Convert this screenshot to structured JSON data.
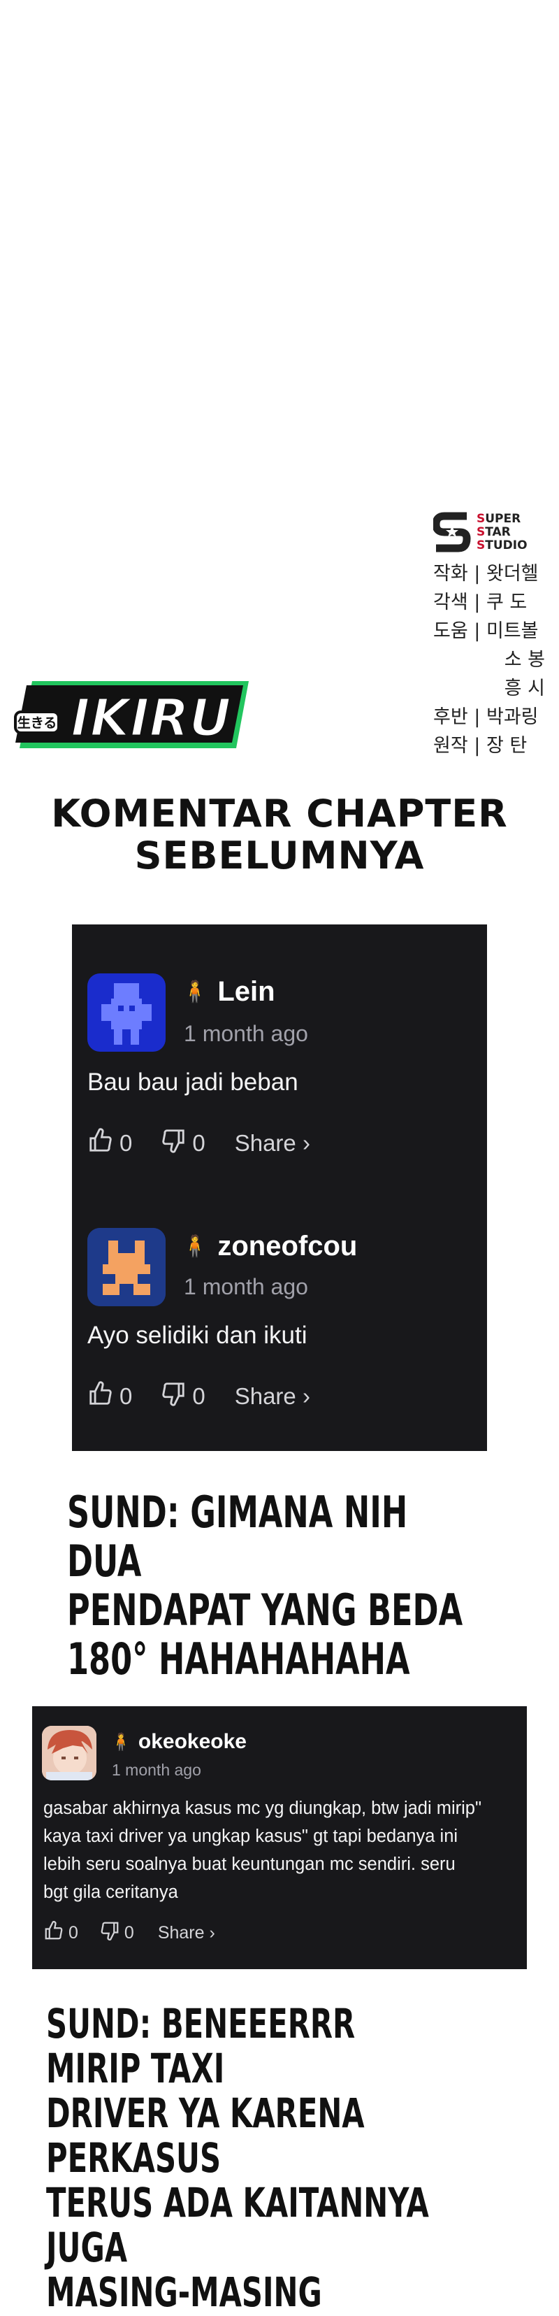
{
  "studio": {
    "logo_lines": [
      "SUPER",
      "STAR",
      "STUDIO"
    ],
    "credits": [
      {
        "role": "작화",
        "sep": "|",
        "name": "왓더헬"
      },
      {
        "role": "각색",
        "sep": "|",
        "name": "쿠 도"
      },
      {
        "role": "도움",
        "sep": "|",
        "name": "미트볼"
      },
      {
        "role": "",
        "sep": "",
        "name": "소 봉"
      },
      {
        "role": "",
        "sep": "",
        "name": "흥 시"
      },
      {
        "role": "후반",
        "sep": "|",
        "name": "박과링"
      },
      {
        "role": "원작",
        "sep": "|",
        "name": "장 탄"
      }
    ]
  },
  "logo": {
    "kana": "生きる",
    "word": "IKIRU"
  },
  "section_title": {
    "line1": "KOMENTAR CHAPTER",
    "line2": "SEBELUMNYA"
  },
  "comments_box1": [
    {
      "username": "Lein",
      "time": "1 month ago",
      "text": "Bau bau jadi beban",
      "likes": "0",
      "dislikes": "0",
      "share": "Share ›",
      "avatar_color": "#1a2ccc"
    },
    {
      "username": "zoneofcou",
      "time": "1 month ago",
      "text": "Ayo selidiki dan ikuti",
      "likes": "0",
      "dislikes": "0",
      "share": "Share ›",
      "avatar_color": "#1e3a8a"
    }
  ],
  "sund1": {
    "lines": [
      "SUND: GIMANA NIH DUA",
      "PENDAPAT YANG BEDA",
      "180° HAHAHAHAHA"
    ]
  },
  "comment_box2": {
    "username": "okeokeoke",
    "time": "1 month ago",
    "text_lines": [
      "gasabar akhirnya kasus mc yg diungkap, btw jadi mirip\"",
      "kaya taxi driver ya ungkap kasus\" gt tapi bedanya ini",
      "lebih seru soalnya buat keuntungan mc sendiri. seru",
      "bgt gila ceritanya"
    ],
    "likes": "0",
    "dislikes": "0",
    "share": "Share ›"
  },
  "sund2": {
    "lines": [
      "SUND: BENEEERRR MIRIP TAXI",
      "DRIVER YA KARENA PERKASUS",
      "TERUS ADA KAITANNYA JUGA",
      "MASING-MASING"
    ]
  },
  "colors": {
    "dark_box": "#18181b",
    "ikiru_green": "#22c55e",
    "studio_red": "#c8102e"
  }
}
